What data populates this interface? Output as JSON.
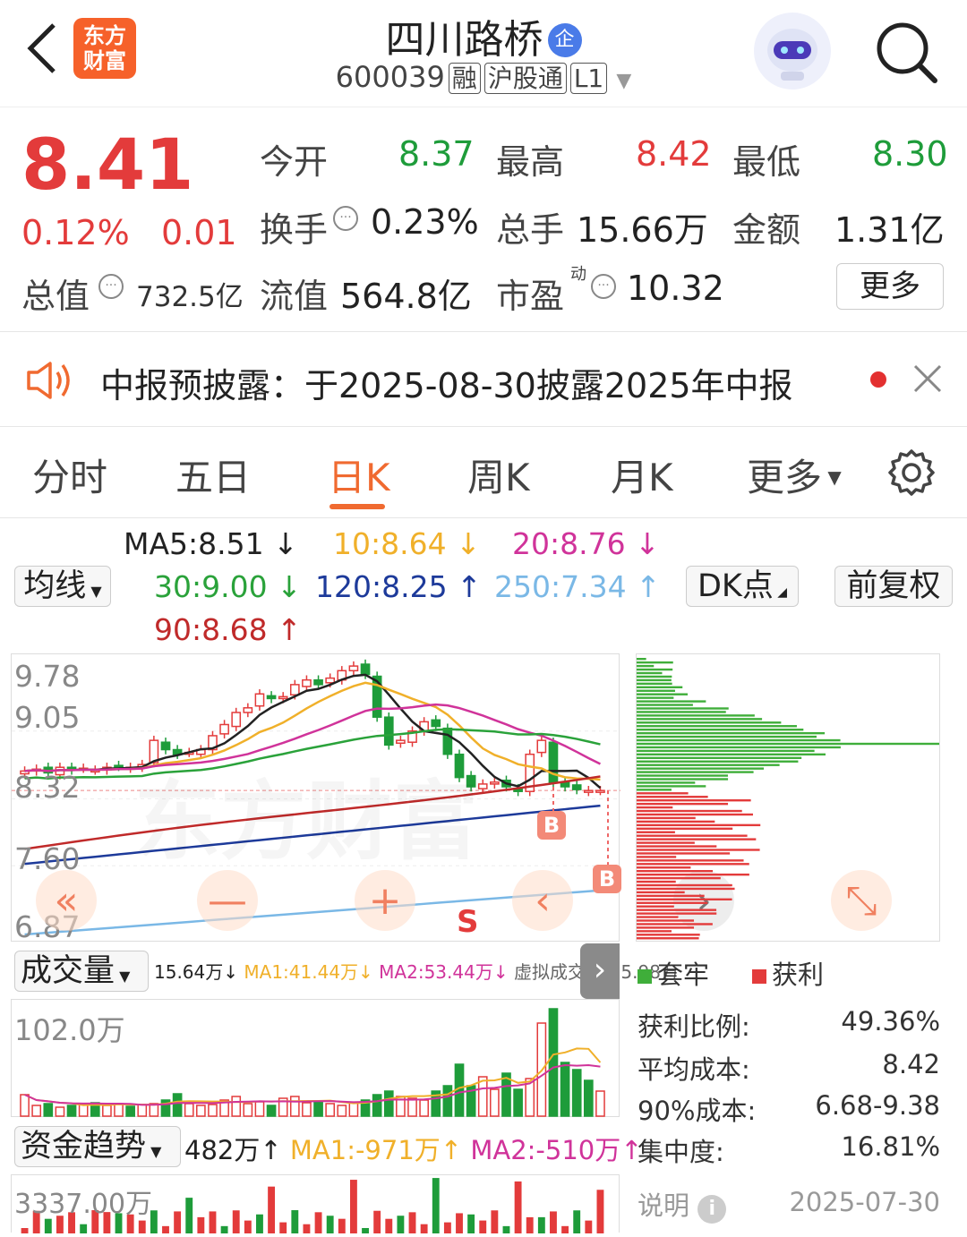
{
  "header": {
    "back_icon": "chevron-left-icon",
    "logo_text_1": "东方",
    "logo_text_2": "财富",
    "stock_name": "四川路桥",
    "enterprise_badge": "企",
    "stock_code": "600039",
    "badges": [
      "融",
      "沪股通",
      "L1"
    ],
    "robot_icon": "robot-avatar-icon",
    "search_icon": "search-icon"
  },
  "quote": {
    "price": "8.41",
    "change_pct": "0.12%",
    "change_abs": "0.01",
    "market_cap_label": "总值",
    "market_cap_value": "732.5亿",
    "open_label": "今开",
    "open_value": "8.37",
    "high_label": "最高",
    "high_value": "8.42",
    "low_label": "最低",
    "low_value": "8.30",
    "turnover_label": "换手",
    "turnover_value": "0.23%",
    "volume_label": "总手",
    "volume_value": "15.66万",
    "amount_label": "金额",
    "amount_value": "1.31亿",
    "float_cap_label": "流值",
    "float_cap_value": "564.8亿",
    "pe_label": "市盈",
    "pe_superscript": "动",
    "pe_value": "10.32",
    "more_button": "更多"
  },
  "notice": {
    "text": "中报预披露：于2025-08-30披露2025年中报"
  },
  "tabs": [
    "分时",
    "五日",
    "日K",
    "周K",
    "月K",
    "更多"
  ],
  "active_tab": "日K",
  "ma": {
    "ma5": "MA5:8.51",
    "ma10": "10:8.64",
    "ma20": "20:8.76",
    "ma30": "30:9.00",
    "ma120": "120:8.25",
    "ma250": "250:7.34",
    "ma90": "90:8.68",
    "selector": "均线",
    "dk_button": "DK点",
    "adjust_button": "前复权"
  },
  "colors": {
    "up": "#e33b3b",
    "down": "#1e9c3a",
    "ma5": "#222222",
    "ma10": "#f0b02a",
    "ma20": "#d0339a",
    "ma30": "#2aa23a",
    "ma120": "#1d3a9a",
    "ma250": "#7ab8e6",
    "ma90": "#c02a2a",
    "accent": "#f06a30"
  },
  "chart_data": [
    {
      "type": "candlestick",
      "ylim": [
        6.87,
        9.78
      ],
      "y_ticks": [
        "9.78",
        "9.05",
        "8.32",
        "7.60",
        "6.87"
      ],
      "markers": [
        "B",
        "B",
        "S"
      ],
      "candles_close": [
        8.62,
        8.64,
        8.6,
        8.66,
        8.63,
        8.65,
        8.63,
        8.66,
        8.67,
        8.66,
        8.69,
        8.95,
        8.85,
        8.8,
        8.82,
        8.85,
        9.0,
        9.12,
        9.25,
        9.3,
        9.45,
        9.4,
        9.42,
        9.55,
        9.6,
        9.55,
        9.62,
        9.7,
        9.75,
        9.66,
        9.2,
        8.9,
        8.95,
        9.05,
        9.15,
        9.1,
        8.8,
        8.55,
        8.45,
        8.48,
        8.5,
        8.45,
        8.4,
        8.8,
        8.95,
        8.5,
        8.45,
        8.42,
        8.41,
        8.41
      ]
    },
    {
      "type": "bar",
      "title": "成交量",
      "y_ticks": [
        "102.0万"
      ],
      "values": [
        24,
        12,
        14,
        10,
        12,
        13,
        15,
        12,
        14,
        11,
        13,
        14,
        18,
        25,
        14,
        12,
        13,
        18,
        22,
        14,
        16,
        12,
        20,
        22,
        15,
        16,
        14,
        12,
        15,
        18,
        24,
        28,
        22,
        20,
        18,
        28,
        34,
        58,
        34,
        44,
        30,
        48,
        30,
        42,
        104,
        120,
        60,
        52,
        40,
        28
      ]
    },
    {
      "type": "bar",
      "title": "资金趋势",
      "y_ticks": [
        "3337.00万"
      ]
    }
  ],
  "volume": {
    "selector": "成交量",
    "value": "15.64万",
    "ma1": "MA1:41.44万",
    "ma2": "MA2:53.44万",
    "virtual": "虚拟成交量:25.98万",
    "y_top": "102.0万"
  },
  "fund": {
    "selector": "资金趋势",
    "value": "482万",
    "ma1": "MA1:-971万",
    "ma2": "MA2:-510万",
    "y_top": "3337.00万"
  },
  "chips": {
    "legend_trapped": "套牢",
    "legend_profit": "获利",
    "rows": [
      {
        "label": "获利比例:",
        "value": "49.36%"
      },
      {
        "label": "平均成本:",
        "value": "8.42"
      },
      {
        "label": "90%成本:",
        "value": "6.68-9.38"
      },
      {
        "label": "集中度:",
        "value": "16.81%"
      }
    ],
    "explain_label": "说明",
    "date": "2025-07-30"
  },
  "watermark": "东方财富"
}
